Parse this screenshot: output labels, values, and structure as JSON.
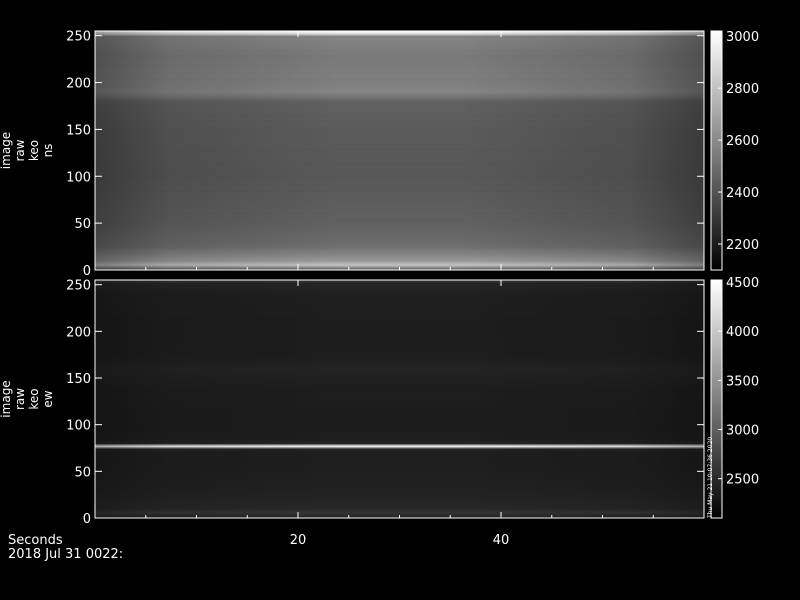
{
  "chart_data": [
    {
      "type": "heatmap",
      "panel": "top",
      "ylabel_lines": [
        "image",
        "raw",
        "keo",
        "ns"
      ],
      "xlim": [
        0,
        60
      ],
      "ylim": [
        0,
        255
      ],
      "yticks": [
        0,
        50,
        100,
        150,
        200,
        250
      ],
      "xticks": [
        20,
        40
      ],
      "colorbar": {
        "min": 2100,
        "max": 3020,
        "ticks": [
          2200,
          2400,
          2600,
          2800,
          3000
        ]
      },
      "profile_y": [
        0,
        5,
        10,
        25,
        50,
        100,
        150,
        180,
        185,
        190,
        200,
        230,
        250,
        253,
        255
      ],
      "profile_value": [
        2400,
        2800,
        2650,
        2500,
        2450,
        2420,
        2430,
        2450,
        2520,
        2580,
        2560,
        2540,
        2580,
        2900,
        3000
      ],
      "vignette": 0.22
    },
    {
      "type": "heatmap",
      "panel": "bottom",
      "ylabel_lines": [
        "image",
        "raw",
        "keo",
        "ew"
      ],
      "xlim": [
        0,
        60
      ],
      "ylim": [
        0,
        255
      ],
      "yticks": [
        0,
        50,
        100,
        150,
        200,
        250
      ],
      "xticks": [
        20,
        40
      ],
      "colorbar": {
        "min": 2100,
        "max": 4520,
        "ticks": [
          2500,
          3000,
          3500,
          4000,
          4500
        ]
      },
      "profile_y": [
        0,
        5,
        10,
        30,
        50,
        70,
        74,
        77,
        80,
        84,
        100,
        140,
        160,
        175,
        200,
        240,
        252,
        255
      ],
      "profile_value": [
        2400,
        2600,
        2480,
        2420,
        2400,
        2390,
        2450,
        4500,
        2450,
        2390,
        2370,
        2390,
        2440,
        2380,
        2380,
        2400,
        2450,
        2600
      ],
      "vignette": 0.18
    }
  ],
  "footer": {
    "x_axis_name": "Seconds",
    "date_label": "2018 Jul 31 0022:",
    "side_stamp": "Thu May 21 10:07:36 2020"
  }
}
